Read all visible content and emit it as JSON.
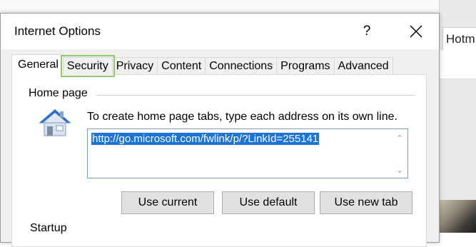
{
  "background": {
    "browser_tab_partial": "Hotm"
  },
  "dialog": {
    "title": "Internet Options",
    "help_label": "?",
    "close_label": "close"
  },
  "tabs": [
    {
      "label": "General",
      "active": true
    },
    {
      "label": "Security",
      "highlighted": true
    },
    {
      "label": "Privacy"
    },
    {
      "label": "Content"
    },
    {
      "label": "Connections"
    },
    {
      "label": "Programs"
    },
    {
      "label": "Advanced"
    }
  ],
  "home_page": {
    "group_label": "Home page",
    "icon": "house-icon",
    "instruction": "To create home page tabs, type each address on its own line.",
    "url_value": "http://go.microsoft.com/fwlink/p/?LinkId=255141",
    "buttons": {
      "use_current": "Use current",
      "use_default": "Use default",
      "use_new_tab": "Use new tab"
    }
  },
  "startup": {
    "group_label": "Startup"
  },
  "colors": {
    "highlight_outline": "#92c86e",
    "selection": "#1e74d6",
    "input_border": "#7a9cc8"
  }
}
